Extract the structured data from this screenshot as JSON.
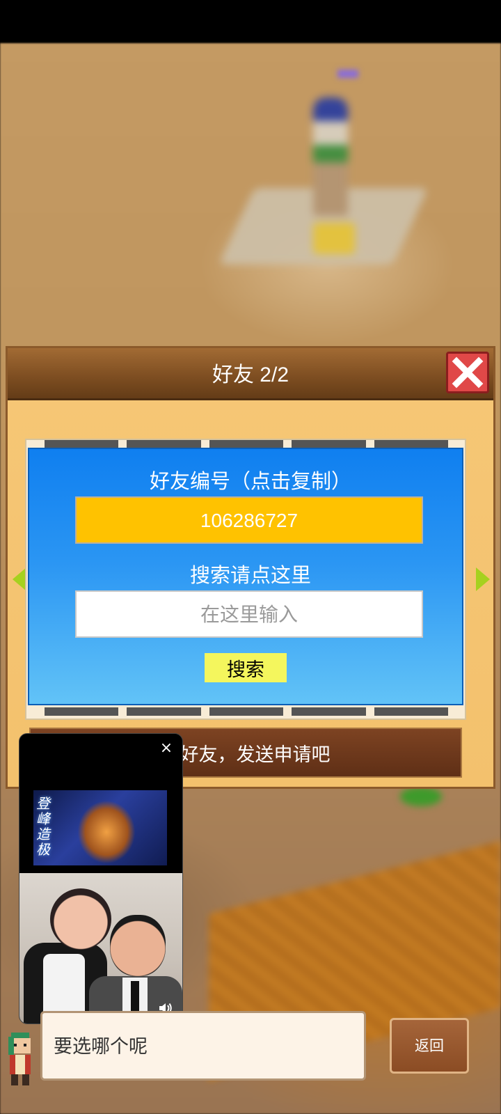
{
  "dialog": {
    "title": "好友    2/2",
    "close_icon": "close-icon",
    "friend_id_label": "好友编号（点击复制）",
    "friend_id": "106286727",
    "search_label": "搜索请点这里",
    "search_placeholder": "在这里输入",
    "search_button": "搜索",
    "hint": "找好友，发送申请吧"
  },
  "video_overlay": {
    "close": "×",
    "thumb_text": "登峰造极"
  },
  "chat": {
    "message": "要选哪个呢",
    "back_button": "返回"
  },
  "colors": {
    "id_box": "#ffc200",
    "panel_blue": "#1f8af1",
    "search_button": "#f4f65d",
    "close_red": "#e04848"
  }
}
